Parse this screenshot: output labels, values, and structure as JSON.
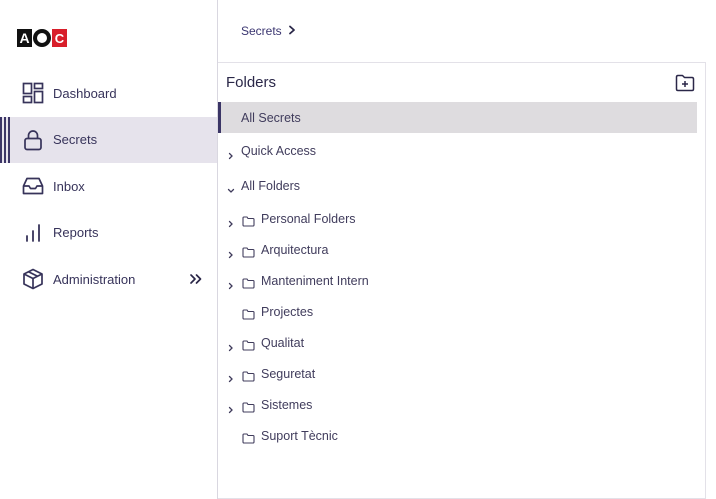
{
  "logo": {
    "letters": [
      "A",
      "O",
      "C"
    ]
  },
  "sidebar": {
    "items": [
      {
        "label": "Dashboard",
        "icon": "dashboard-icon",
        "active": false
      },
      {
        "label": "Secrets",
        "icon": "lock-icon",
        "active": true
      },
      {
        "label": "Inbox",
        "icon": "inbox-icon",
        "active": false
      },
      {
        "label": "Reports",
        "icon": "bar-chart-icon",
        "active": false
      },
      {
        "label": "Administration",
        "icon": "box-icon",
        "active": false,
        "expand_icon": "double-chevron-right-icon"
      }
    ]
  },
  "breadcrumb": {
    "items": [
      "Secrets"
    ]
  },
  "folders_panel": {
    "title": "Folders",
    "add_icon": "add-folder-icon",
    "all_secrets": "All Secrets",
    "quick_access": "Quick Access",
    "all_folders": "All Folders",
    "folders": [
      {
        "name": "Personal Folders",
        "expandable": true
      },
      {
        "name": "Arquitectura",
        "expandable": true
      },
      {
        "name": "Manteniment Intern",
        "expandable": true
      },
      {
        "name": "Projectes",
        "expandable": false
      },
      {
        "name": "Qualitat",
        "expandable": true
      },
      {
        "name": "Seguretat",
        "expandable": true
      },
      {
        "name": "Sistemes",
        "expandable": true
      },
      {
        "name": "Suport Tècnic",
        "expandable": false
      }
    ]
  },
  "colors": {
    "accent": "#3b3566",
    "active_bg": "#e6e3ec",
    "selected_bg": "#dedcdf",
    "logo_red": "#d81e2a"
  }
}
